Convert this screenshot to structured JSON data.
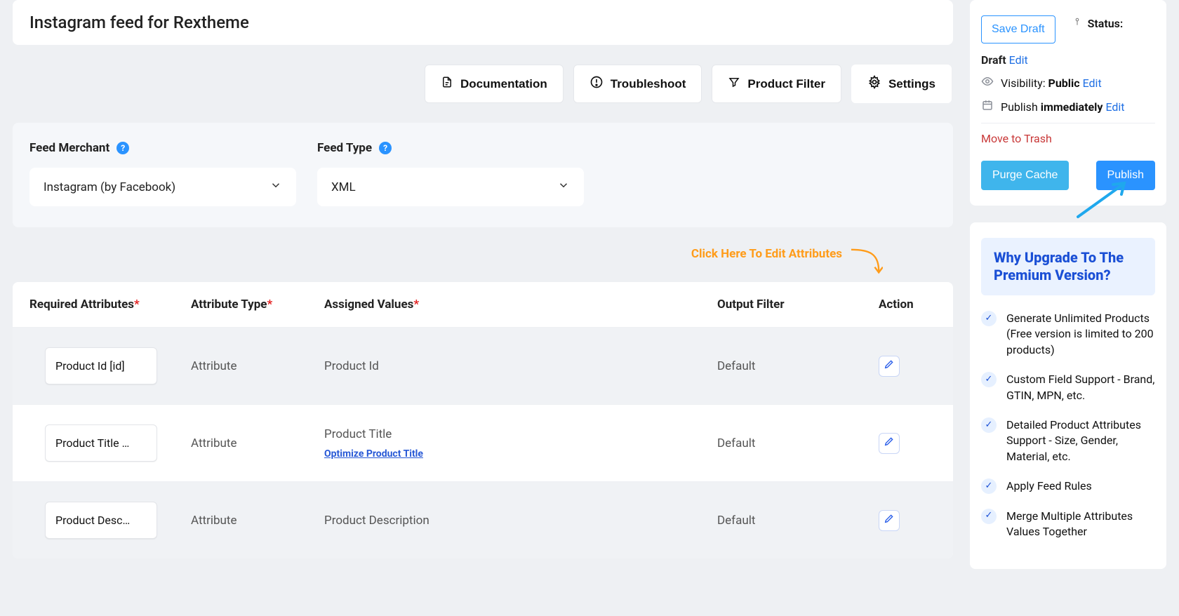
{
  "title": "Instagram feed for Rextheme",
  "toolbar": {
    "documentation": "Documentation",
    "troubleshoot": "Troubleshoot",
    "product_filter": "Product Filter",
    "settings": "Settings"
  },
  "config": {
    "merchant_label": "Feed Merchant",
    "merchant_value": "Instagram (by Facebook)",
    "type_label": "Feed Type",
    "type_value": "XML"
  },
  "cta_text": "Click Here To Edit Attributes",
  "table": {
    "headers": {
      "required": "Required Attributes",
      "attr_type": "Attribute Type",
      "assigned": "Assigned Values",
      "output_filter": "Output Filter",
      "action": "Action"
    },
    "rows": [
      {
        "name": "Product Id [id]",
        "type": "Attribute",
        "assigned": "Product Id",
        "optimize": null,
        "filter": "Default"
      },
      {
        "name": "Product Title …",
        "type": "Attribute",
        "assigned": "Product Title",
        "optimize": "Optimize Product Title",
        "filter": "Default"
      },
      {
        "name": "Product Desc…",
        "type": "Attribute",
        "assigned": "Product Description",
        "optimize": null,
        "filter": "Default"
      }
    ]
  },
  "sidebar": {
    "publish_box": {
      "save_draft": "Save Draft",
      "status_label": "Status:",
      "status_value": "Draft",
      "edit": "Edit",
      "visibility_label": "Visibility:",
      "visibility_value": "Public",
      "publish_time_label": "Publish",
      "publish_time_value": "immediately",
      "move_to_trash": "Move to Trash",
      "purge_cache": "Purge Cache",
      "publish": "Publish"
    },
    "promo": {
      "heading": "Why Upgrade To The Premium Version?",
      "items": [
        "Generate Unlimited Products (Free version is limited to 200 products)",
        "Custom Field Support - Brand, GTIN, MPN, etc.",
        "Detailed Product Attributes Support - Size, Gender, Material, etc.",
        "Apply Feed Rules",
        "Merge Multiple Attributes Values Together"
      ]
    }
  }
}
